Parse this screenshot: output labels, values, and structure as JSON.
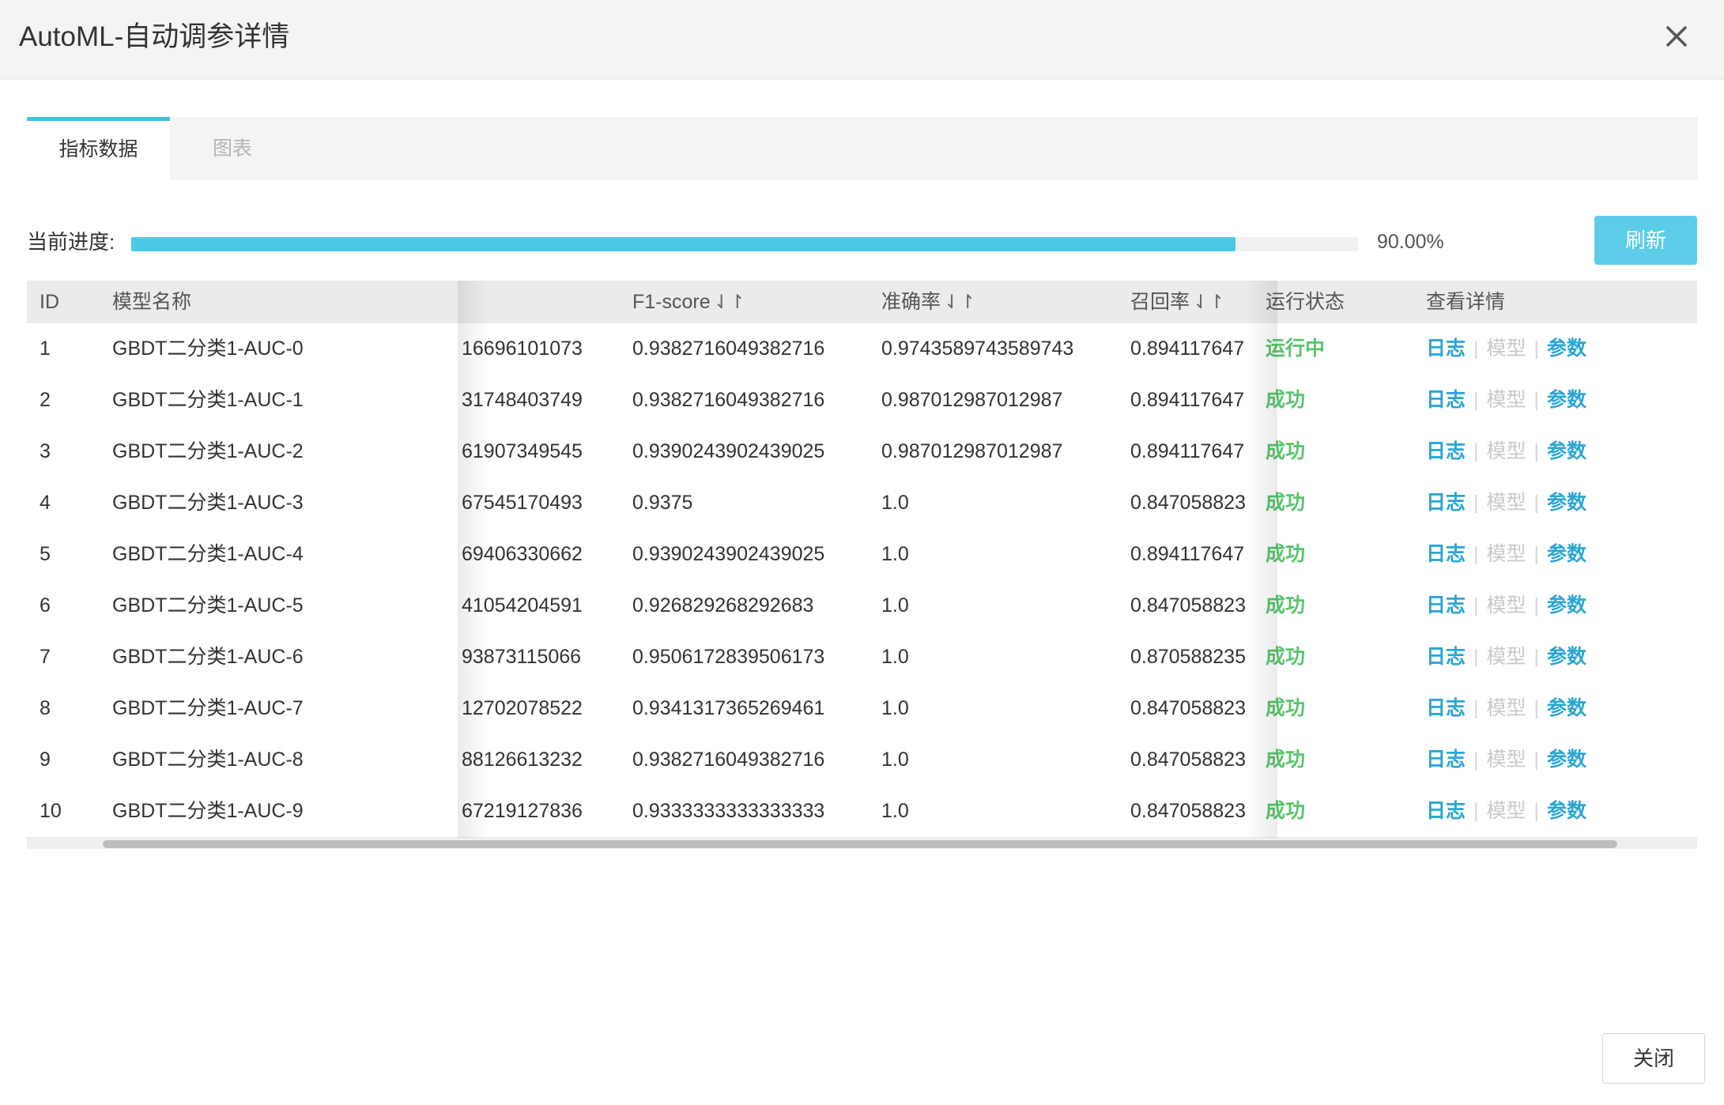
{
  "dialog": {
    "title": "AutoML-自动调参详情"
  },
  "tabs": [
    {
      "label": "指标数据",
      "active": true
    },
    {
      "label": "图表",
      "active": false
    }
  ],
  "progress": {
    "label": "当前进度:",
    "value": 0.9,
    "text": "90.00%",
    "refresh_label": "刷新"
  },
  "table": {
    "columns": {
      "id": "ID",
      "name": "模型名称",
      "f1": "F1-score",
      "acc": "准确率",
      "recall": "召回率",
      "status": "运行状态",
      "details": "查看详情",
      "sort_icon": "⇃↾"
    },
    "rows": [
      {
        "id": "1",
        "name": "GBDT二分类1-AUC-0",
        "auc": "16696101073",
        "f1": "0.9382716049382716",
        "acc": "0.9743589743589743",
        "recall": "0.894117647",
        "status": "运行中"
      },
      {
        "id": "2",
        "name": "GBDT二分类1-AUC-1",
        "auc": "31748403749",
        "f1": "0.9382716049382716",
        "acc": "0.987012987012987",
        "recall": "0.894117647",
        "status": "成功"
      },
      {
        "id": "3",
        "name": "GBDT二分类1-AUC-2",
        "auc": "61907349545",
        "f1": "0.9390243902439025",
        "acc": "0.987012987012987",
        "recall": "0.894117647",
        "status": "成功"
      },
      {
        "id": "4",
        "name": "GBDT二分类1-AUC-3",
        "auc": "67545170493",
        "f1": "0.9375",
        "acc": "1.0",
        "recall": "0.847058823",
        "status": "成功"
      },
      {
        "id": "5",
        "name": "GBDT二分类1-AUC-4",
        "auc": "69406330662",
        "f1": "0.9390243902439025",
        "acc": "1.0",
        "recall": "0.894117647",
        "status": "成功"
      },
      {
        "id": "6",
        "name": "GBDT二分类1-AUC-5",
        "auc": "41054204591",
        "f1": "0.926829268292683",
        "acc": "1.0",
        "recall": "0.847058823",
        "status": "成功"
      },
      {
        "id": "7",
        "name": "GBDT二分类1-AUC-6",
        "auc": "93873115066",
        "f1": "0.9506172839506173",
        "acc": "1.0",
        "recall": "0.870588235",
        "status": "成功"
      },
      {
        "id": "8",
        "name": "GBDT二分类1-AUC-7",
        "auc": "12702078522",
        "f1": "0.9341317365269461",
        "acc": "1.0",
        "recall": "0.847058823",
        "status": "成功"
      },
      {
        "id": "9",
        "name": "GBDT二分类1-AUC-8",
        "auc": "88126613232",
        "f1": "0.9382716049382716",
        "acc": "1.0",
        "recall": "0.847058823",
        "status": "成功"
      },
      {
        "id": "10",
        "name": "GBDT二分类1-AUC-9",
        "auc": "67219127836",
        "f1": "0.9333333333333333",
        "acc": "1.0",
        "recall": "0.847058823",
        "status": "成功"
      }
    ],
    "actions": {
      "log": "日志",
      "model": "模型",
      "params": "参数",
      "separator": "|"
    }
  },
  "footer": {
    "close_label": "关闭"
  },
  "icons": {
    "close": "close-icon"
  },
  "colors": {
    "accent": "#3ec3e0",
    "success": "#58c46b",
    "link": "#2aa6d6",
    "progress": "#4cc9e8"
  }
}
